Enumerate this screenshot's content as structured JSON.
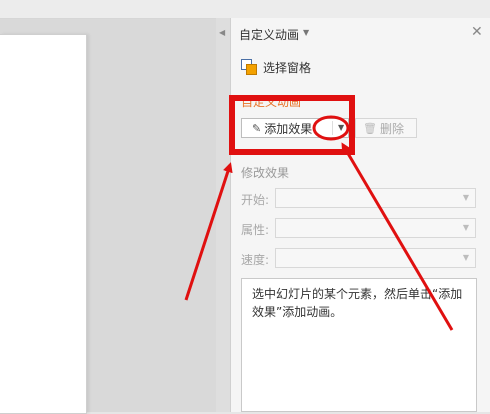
{
  "panel": {
    "title": "自定义动画",
    "close_glyph": "✕",
    "select_pane_label": "选择窗格",
    "section_label": "自定义动画",
    "add_effect_label": "添加效果",
    "delete_label": "删除",
    "modify_label": "修改效果",
    "fields": [
      {
        "label": "开始:",
        "value": ""
      },
      {
        "label": "属性:",
        "value": ""
      },
      {
        "label": "速度:",
        "value": ""
      }
    ],
    "description": "选中幻灯片的某个元素，然后单击“添加效果”添加动画。"
  },
  "colors": {
    "section_orange": "#e8742a",
    "annotation_red": "#e01010"
  },
  "icons": {
    "collapse": "triangle-left-icon",
    "caret": "chevron-down-icon",
    "add_effect": "pen-icon",
    "delete": "trash-icon",
    "select_pane": "select-pane-icon"
  }
}
